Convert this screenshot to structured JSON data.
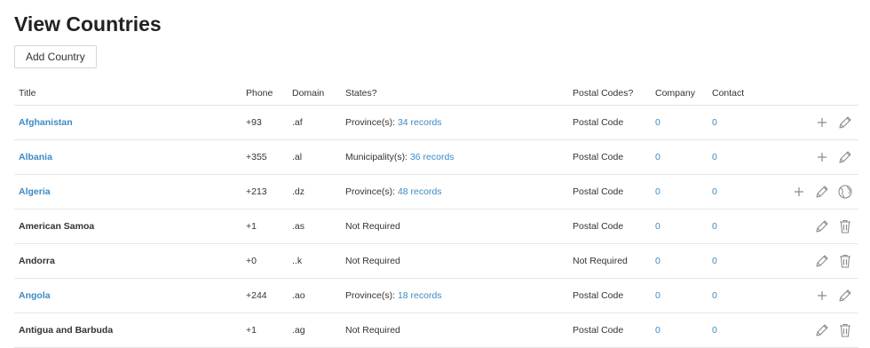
{
  "page": {
    "title": "View Countries",
    "add_button_label": "Add Country"
  },
  "table": {
    "headers": {
      "title": "Title",
      "phone": "Phone",
      "domain": "Domain",
      "states": "States?",
      "postal": "Postal Codes?",
      "company": "Company",
      "contact": "Contact"
    },
    "rows": [
      {
        "title": "Afghanistan",
        "title_link": true,
        "phone": "+93",
        "domain": ".af",
        "states_prefix": "Province(s): ",
        "states_link": "34 records",
        "postal": "Postal Code",
        "company": "0",
        "contact": "0",
        "actions": [
          "plus-icon",
          "pencil-icon"
        ]
      },
      {
        "title": "Albania",
        "title_link": true,
        "phone": "+355",
        "domain": ".al",
        "states_prefix": "Municipality(s): ",
        "states_link": "36 records",
        "postal": "Postal Code",
        "company": "0",
        "contact": "0",
        "actions": [
          "plus-icon",
          "pencil-icon"
        ]
      },
      {
        "title": "Algeria",
        "title_link": true,
        "phone": "+213",
        "domain": ".dz",
        "states_prefix": "Province(s): ",
        "states_link": "48 records",
        "postal": "Postal Code",
        "company": "0",
        "contact": "0",
        "actions": [
          "plus-icon",
          "pencil-icon",
          "globe-icon"
        ]
      },
      {
        "title": "American Samoa",
        "title_link": false,
        "phone": "+1",
        "domain": ".as",
        "states_prefix": "Not Required",
        "states_link": "",
        "postal": "Postal Code",
        "company": "0",
        "contact": "0",
        "actions": [
          "pencil-icon",
          "trash-icon"
        ]
      },
      {
        "title": "Andorra",
        "title_link": false,
        "phone": "+0",
        "domain": "..k",
        "states_prefix": "Not Required",
        "states_link": "",
        "postal": "Not Required",
        "company": "0",
        "contact": "0",
        "actions": [
          "pencil-icon",
          "trash-icon"
        ]
      },
      {
        "title": "Angola",
        "title_link": true,
        "phone": "+244",
        "domain": ".ao",
        "states_prefix": "Province(s): ",
        "states_link": "18 records",
        "postal": "Postal Code",
        "company": "0",
        "contact": "0",
        "actions": [
          "plus-icon",
          "pencil-icon"
        ]
      },
      {
        "title": "Antigua and Barbuda",
        "title_link": false,
        "phone": "+1",
        "domain": ".ag",
        "states_prefix": "Not Required",
        "states_link": "",
        "postal": "Postal Code",
        "company": "0",
        "contact": "0",
        "actions": [
          "pencil-icon",
          "trash-icon"
        ]
      }
    ]
  },
  "colors": {
    "link": "#3d8bc4",
    "icon": "#8a8a8a",
    "text": "#333333"
  }
}
